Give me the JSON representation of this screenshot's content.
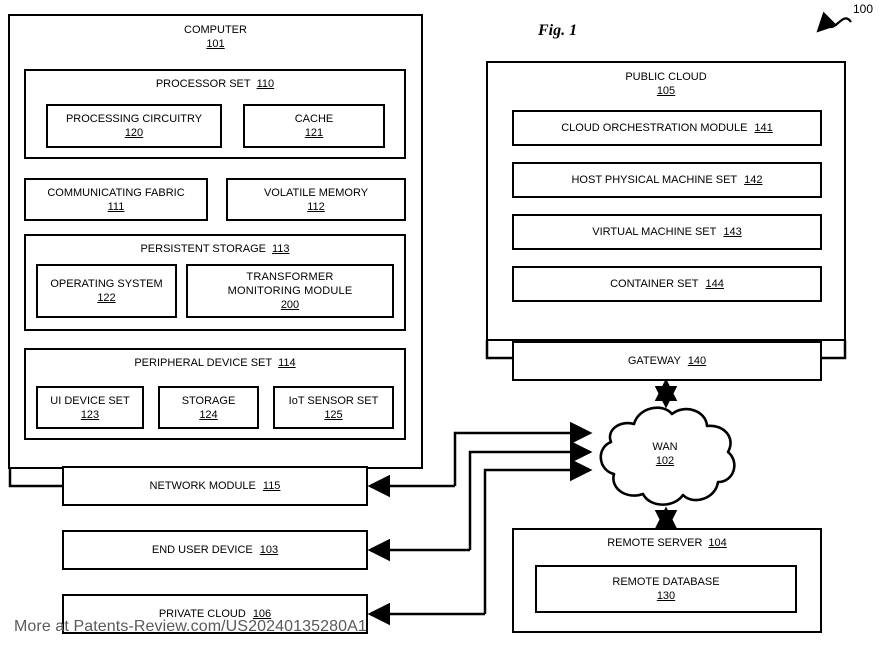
{
  "figure": {
    "caption": "Fig. 1",
    "ref_number": "100"
  },
  "watermark": {
    "text": "More at Patents-Review.com/US20240135280A1"
  },
  "computer": {
    "label": "COMPUTER",
    "num": "101",
    "processor_set": {
      "label": "PROCESSOR SET",
      "num": "110",
      "children": [
        {
          "label": "PROCESSING CIRCUITRY",
          "num": "120"
        },
        {
          "label": "CACHE",
          "num": "121"
        }
      ]
    },
    "memory_row": [
      {
        "label": "COMMUNICATING FABRIC",
        "num": "111"
      },
      {
        "label": "VOLATILE MEMORY",
        "num": "112"
      }
    ],
    "persistent_storage": {
      "label": "PERSISTENT STORAGE",
      "num": "113",
      "children": [
        {
          "label": "OPERATING SYSTEM",
          "num": "122"
        },
        {
          "label": "TRANSFORMER MONITORING MODULE",
          "num": "200"
        }
      ]
    },
    "peripheral_device_set": {
      "label": "PERIPHERAL DEVICE SET",
      "num": "114",
      "children": [
        {
          "label": "UI DEVICE SET",
          "num": "123"
        },
        {
          "label": "STORAGE",
          "num": "124"
        },
        {
          "label": "IoT SENSOR SET",
          "num": "125"
        }
      ]
    },
    "network_module": {
      "label": "NETWORK MODULE",
      "num": "115"
    }
  },
  "end_user_device": {
    "label": "END USER DEVICE",
    "num": "103"
  },
  "private_cloud": {
    "label": "PRIVATE CLOUD",
    "num": "106"
  },
  "public_cloud": {
    "label": "PUBLIC CLOUD",
    "num": "105",
    "children": [
      {
        "label": "CLOUD ORCHESTRATION MODULE",
        "num": "141"
      },
      {
        "label": "HOST PHYSICAL MACHINE SET",
        "num": "142"
      },
      {
        "label": "VIRTUAL MACHINE SET",
        "num": "143"
      },
      {
        "label": "CONTAINER SET",
        "num": "144"
      }
    ],
    "gateway": {
      "label": "GATEWAY",
      "num": "140"
    }
  },
  "wan": {
    "label": "WAN",
    "num": "102"
  },
  "remote_server": {
    "label": "REMOTE SERVER",
    "num": "104",
    "database": {
      "label": "REMOTE DATABASE",
      "num": "130"
    }
  },
  "colors": {
    "line": "#000000",
    "background": "#ffffff",
    "watermark": "#5a5a5a"
  }
}
